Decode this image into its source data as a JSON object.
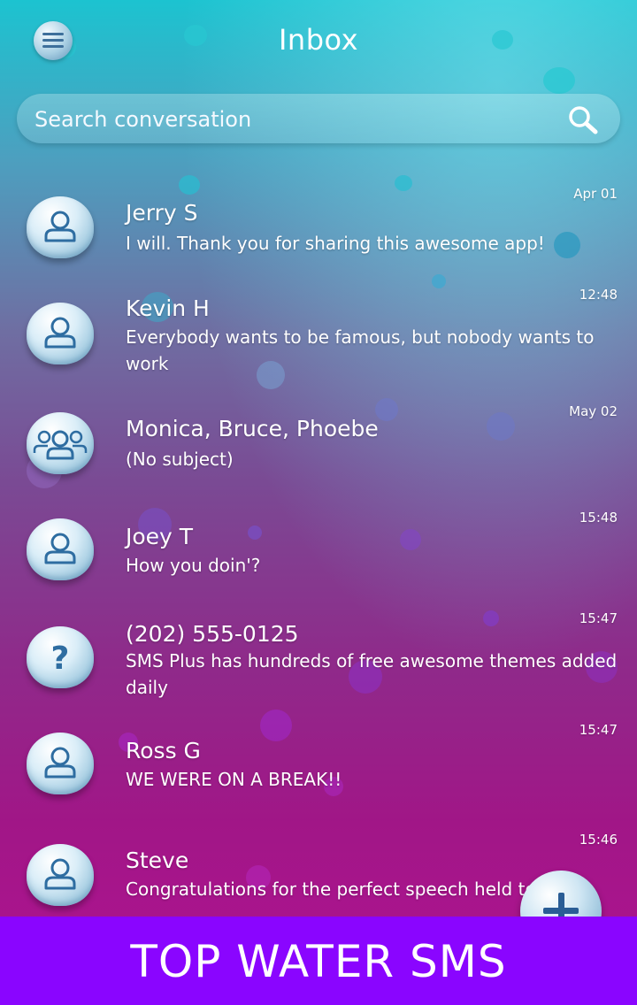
{
  "header": {
    "title": "Inbox",
    "menu_icon": "hamburger-menu-icon"
  },
  "search": {
    "placeholder": "Search conversation",
    "icon": "search-icon"
  },
  "conversations": [
    {
      "name": "Jerry S",
      "preview": "I will. Thank you for sharing this awesome app!",
      "time": "Apr 01",
      "avatar": "person-icon"
    },
    {
      "name": "Kevin H",
      "preview": "Everybody wants to be famous, but nobody wants to work",
      "time": "12:48",
      "avatar": "person-icon"
    },
    {
      "name": "Monica, Bruce, Phoebe",
      "preview": "(No subject)",
      "time": "May 02",
      "avatar": "group-icon"
    },
    {
      "name": "Joey T",
      "preview": "How you doin'?",
      "time": "15:48",
      "avatar": "person-icon"
    },
    {
      "name": "(202) 555-0125",
      "preview": "SMS Plus has hundreds of free awesome themes added daily",
      "time": "15:47",
      "avatar": "unknown-contact-icon"
    },
    {
      "name": "Ross G",
      "preview": "WE WERE ON A BREAK!!",
      "time": "15:47",
      "avatar": "person-icon"
    },
    {
      "name": "Steve",
      "preview": "Congratulations for the perfect speech held to",
      "time": "15:46",
      "avatar": "person-icon"
    }
  ],
  "compose_icon": "plus-icon",
  "banner": {
    "text": "TOP WATER SMS",
    "color": "#8a05ff"
  }
}
